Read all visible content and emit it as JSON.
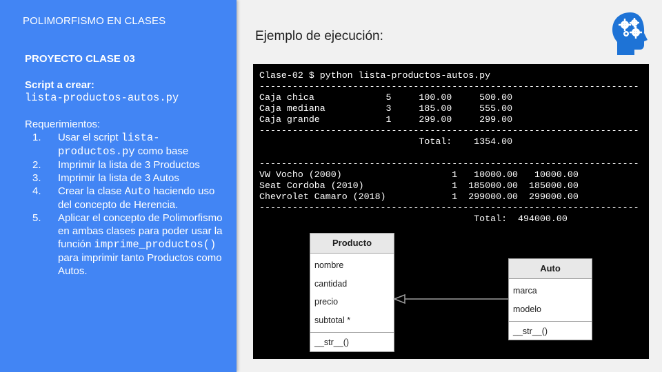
{
  "slide": {
    "title": "POLIMORFISMO EN CLASES",
    "project": "PROYECTO CLASE 03",
    "script_label": "Script a crear:",
    "script_name": "lista-productos-autos.py",
    "requirements_label": "Requerimientos:",
    "requirements": [
      {
        "num": "1.",
        "pre": "Usar el script ",
        "code": "lista-productos.py",
        "post": " como base"
      },
      {
        "num": "2.",
        "pre": "Imprimir la lista de 3 Productos",
        "code": "",
        "post": ""
      },
      {
        "num": "3.",
        "pre": "Imprimir la lista de 3 Autos",
        "code": "",
        "post": ""
      },
      {
        "num": "4.",
        "pre": "Crear la clase ",
        "code": "Auto",
        "post": " haciendo uso del concepto de Herencia."
      },
      {
        "num": "5.",
        "pre": "Aplicar el concepto de Polimorfismo en ambas clases para poder usar la función ",
        "code": "imprime_productos()",
        "post": " para imprimir tanto Productos como Autos."
      }
    ]
  },
  "example_heading": "Ejemplo de ejecución:",
  "terminal": {
    "lines": [
      "Clase-02 $ python lista-productos-autos.py",
      "---------------------------------------------------------------------",
      "Caja chica             5     100.00     500.00",
      "Caja mediana           3     185.00     555.00",
      "Caja grande            1     299.00     299.00",
      "---------------------------------------------------------------------",
      "                             Total:    1354.00",
      "",
      "---------------------------------------------------------------------",
      "VW Vocho (2000)                    1   10000.00   10000.00",
      "Seat Cordoba (2010)                1  185000.00  185000.00",
      "Chevrolet Camaro (2018)            1  299000.00  299000.00",
      "---------------------------------------------------------------------",
      "                                       Total:  494000.00"
    ]
  },
  "uml": {
    "producto": {
      "name": "Producto",
      "attributes": [
        "nombre",
        "cantidad",
        "precio",
        "subtotal *"
      ],
      "methods": [
        "__str__()"
      ]
    },
    "auto": {
      "name": "Auto",
      "attributes": [
        "marca",
        "modelo"
      ],
      "methods": [
        "__str__()"
      ]
    }
  },
  "logo_icon": "brain-gears-icon"
}
